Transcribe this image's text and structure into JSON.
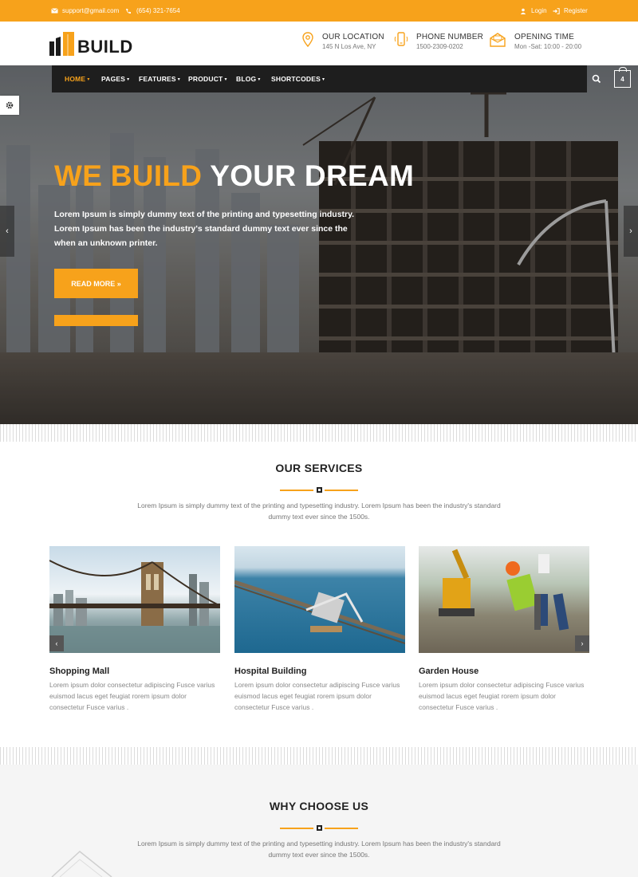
{
  "topbar": {
    "email": "support@gmail.com",
    "phone": "(654) 321-7654",
    "login": "Login",
    "register": "Register"
  },
  "brand": {
    "logo_text": "BUILD"
  },
  "header_info": [
    {
      "title": "OUR LOCATION",
      "sub": "145 N Los Ave, NY",
      "icon": "map-pin-icon"
    },
    {
      "title": "PHONE NUMBER",
      "sub": "1500-2309-0202",
      "icon": "mobile-phone-icon"
    },
    {
      "title": "OPENING TIME",
      "sub": "Mon -Sat: 10:00 - 20:00",
      "icon": "envelope-icon"
    }
  ],
  "nav": {
    "items": [
      {
        "label": "HOME"
      },
      {
        "label": "PAGES"
      },
      {
        "label": "FEATURES"
      },
      {
        "label": "PRODUCT"
      },
      {
        "label": "BLOG"
      },
      {
        "label": "SHORTCODES"
      }
    ],
    "cart_count": "4"
  },
  "hero": {
    "title_highlight": "WE BUILD",
    "title_rest": "YOUR DREAM",
    "text": "Lorem Ipsum is simply dummy text of the printing and typesetting industry. Lorem Ipsum has been the industry's standard dummy text ever since the when an unknown printer.",
    "button": "READ MORE »"
  },
  "services": {
    "title": "OUR SERVICES",
    "desc": "Lorem Ipsum is simply dummy text of the printing and typesetting industry. Lorem Ipsum has been the industry's standard dummy text ever since the 1500s.",
    "cards": [
      {
        "name": "Shopping Mall",
        "desc": "Lorem ipsum dolor consectetur adipiscing Fusce varius euismod lacus eget feugiat rorem ipsum dolor consectetur Fusce varius ."
      },
      {
        "name": "Hospital Building",
        "desc": "Lorem ipsum dolor consectetur adipiscing Fusce varius euismod lacus eget feugiat rorem ipsum dolor consectetur Fusce varius ."
      },
      {
        "name": "Garden House",
        "desc": "Lorem ipsum dolor consectetur adipiscing Fusce varius euismod lacus eget feugiat rorem ipsum dolor consectetur Fusce varius ."
      }
    ]
  },
  "why": {
    "title": "WHY CHOOSE US",
    "desc": "Lorem Ipsum is simply dummy text of the printing and typesetting industry. Lorem Ipsum has been the industry's standard dummy text ever since the 1500s."
  },
  "colors": {
    "accent": "#f7a21b",
    "nav_bg": "#1e1e1e"
  }
}
